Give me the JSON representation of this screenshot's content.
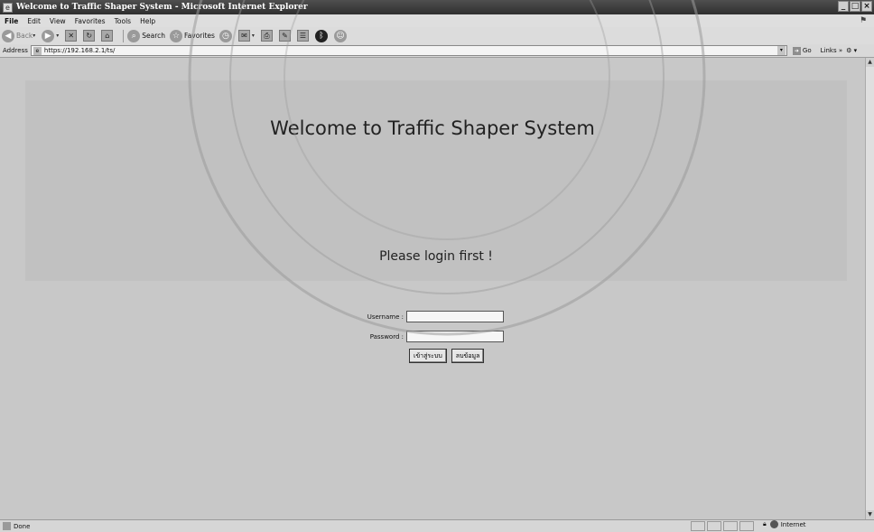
{
  "window": {
    "title": "Welcome to Traffic Shaper System - Microsoft Internet Explorer"
  },
  "menu": {
    "items": [
      "File",
      "Edit",
      "View",
      "Favorites",
      "Tools",
      "Help"
    ]
  },
  "toolbar": {
    "back_label": "Back",
    "search_label": "Search",
    "favorites_label": "Favorites"
  },
  "address": {
    "label": "Address",
    "url": "https://192.168.2.1/ts/",
    "go_label": "Go",
    "links_label": "Links"
  },
  "page": {
    "heading": "Welcome to Traffic Shaper System",
    "prompt": "Please login first !",
    "username_label": "Username :",
    "password_label": "Password :",
    "login_button": "เข้าสู่ระบบ",
    "clear_button": "ลบข้อมูล"
  },
  "status": {
    "text": "Done",
    "zone": "Internet"
  }
}
